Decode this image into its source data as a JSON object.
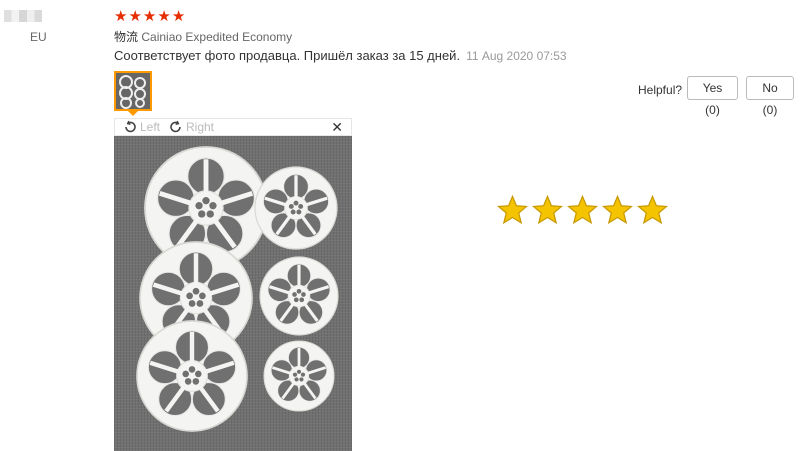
{
  "reviewer": {
    "country": "EU"
  },
  "rating": {
    "stars": 5,
    "star_glyph": "★",
    "color": "#e62e04"
  },
  "shipping": {
    "label": "物流",
    "method": "Cainiao Expedited Economy"
  },
  "review": {
    "text": "Соответствует фото продавца. Пришёл заказ за 15 дней.",
    "date": "11 Aug 2020 07:53"
  },
  "helpful": {
    "label": "Helpful?",
    "yes_label": "Yes (0)",
    "no_label": "No (0)"
  },
  "viewer": {
    "rotate_left_label": "Left",
    "rotate_right_label": "Right",
    "rotate_left_icon": "rotate-left-icon",
    "rotate_right_icon": "rotate-right-icon",
    "close_icon": "close-icon",
    "close_glyph": "✕"
  },
  "overlay_rating": {
    "stars": 5,
    "color": "#f5c400"
  }
}
